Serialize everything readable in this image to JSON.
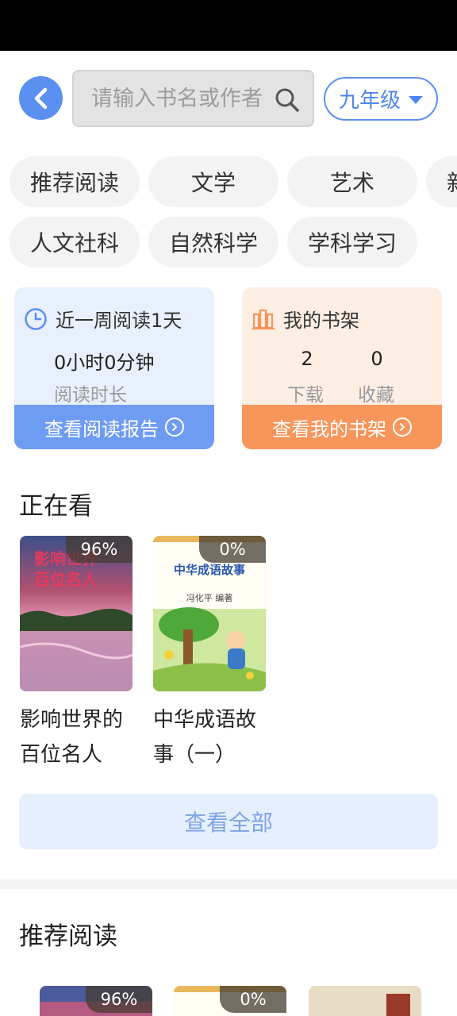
{
  "search": {
    "placeholder": "请输入书名或作者"
  },
  "grade": {
    "label": "九年级"
  },
  "categories": [
    {
      "label": "推荐阅读"
    },
    {
      "label": "文学"
    },
    {
      "label": "艺术"
    },
    {
      "label": "新"
    },
    {
      "label": "人文社科"
    },
    {
      "label": "自然科学"
    },
    {
      "label": "学科学习"
    }
  ],
  "reading_card": {
    "title": "近一周阅读1天",
    "duration": "0小时0分钟",
    "duration_label": "阅读时长",
    "action": "查看阅读报告",
    "icon": "clock-icon"
  },
  "shelf_card": {
    "title": "我的书架",
    "downloads": "2",
    "downloads_label": "下载",
    "favorites": "0",
    "favorites_label": "收藏",
    "action": "查看我的书架",
    "icon": "bookshelf-icon"
  },
  "watching": {
    "title": "正在看",
    "books": [
      {
        "title": "影响世界的百位名人",
        "progress": "96%",
        "cover_title": "影响世界的百位名人"
      },
      {
        "title": "中华成语故事（一）",
        "progress": "0%",
        "cover_title": "中华成语故事",
        "cover_author": "冯化平 编著"
      }
    ],
    "view_all": "查看全部"
  },
  "recommend": {
    "title": "推荐阅读",
    "books": [
      {
        "progress": "96%"
      },
      {
        "progress": "0%"
      },
      {
        "progress": ""
      }
    ]
  },
  "colors": {
    "accent": "#5b8ff0",
    "orange": "#f8955a"
  }
}
